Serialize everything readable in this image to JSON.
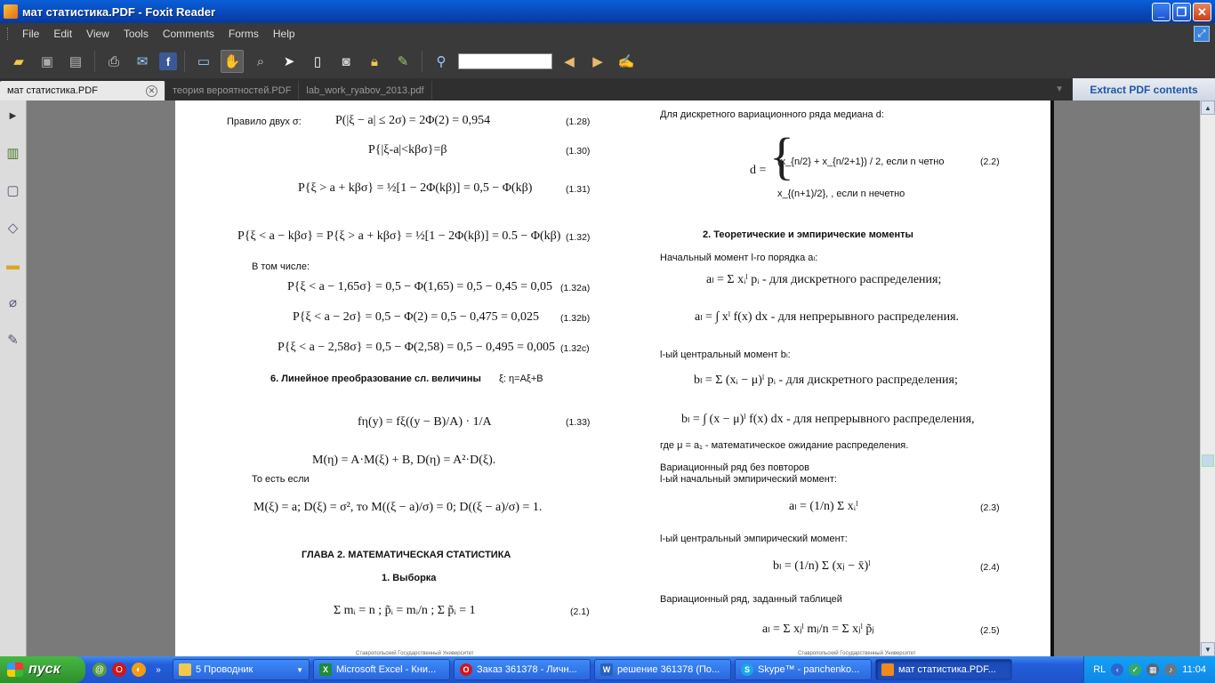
{
  "window": {
    "title": "мат статистика.PDF - Foxit Reader",
    "buttons": {
      "minimize": "_",
      "maximize": "❐",
      "close": "✕"
    }
  },
  "menu": [
    "File",
    "Edit",
    "View",
    "Tools",
    "Comments",
    "Forms",
    "Help"
  ],
  "toolbar": {
    "icons": [
      "open-icon",
      "save-icon",
      "print-setup-icon",
      "print-icon",
      "email-icon",
      "facebook-icon",
      "fullscreen-icon",
      "hand-tool-icon",
      "zoom-tool-icon",
      "select-tool-icon",
      "text-select-icon",
      "snapshot-icon",
      "rms-lock-icon",
      "sign-icon",
      "find-icon",
      "prev-icon",
      "next-icon",
      "typewriter-icon"
    ],
    "find_value": ""
  },
  "tabs": [
    {
      "label": "мат статистика.PDF",
      "active": true
    },
    {
      "label": "теория вероятностей.PDF",
      "active": false
    },
    {
      "label": "lab_work_ryabov_2013.pdf",
      "active": false
    }
  ],
  "extract_label": "Extract PDF contents",
  "left_panel": [
    "bookmarks-icon",
    "pages-icon",
    "layers-icon",
    "comments-icon",
    "attachments-icon",
    "signatures-icon"
  ],
  "page": {
    "left": {
      "rule_label": "Правило двух σ:",
      "eq128": "P(|ξ − a| ≤ 2σ) = 2Φ(2) = 0,954",
      "eq128_num": "(1.28)",
      "eq130": "P{|ξ-a|<kβσ}=β",
      "eq130_num": "(1.30)",
      "eq131": "P{ξ > a + kβσ} = ½[1 − 2Φ(kβ)] = 0,5 − Φ(kβ)",
      "eq131_num": "(1.31)",
      "eq132": "P{ξ < a − kβσ} = P{ξ > a + kβσ} = ½[1 − 2Φ(kβ)] = 0.5 − Φ(kβ)",
      "eq132_num": "(1.32)",
      "in_particular": "В том числе:",
      "eq132a": "P{ξ < a − 1,65σ} = 0,5 − Φ(1,65) = 0,5 − 0,45 = 0,05",
      "eq132a_num": "(1.32a)",
      "eq132b": "P{ξ < a − 2σ} = 0,5 − Φ(2) = 0,5 − 0,475 = 0,025",
      "eq132b_num": "(1.32b)",
      "eq132c": "P{ξ < a − 2,58σ} = 0,5 − Φ(2,58) = 0,5 − 0,495 = 0,005",
      "eq132c_num": "(1.32c)",
      "section6": "6.  Линейное  преобразование  сл.  величины",
      "section6_tail": "ξ:  η=Aξ+B",
      "eq133": "fη(y) = fξ((y − B)/A) · 1/A",
      "eq133_num": "(1.33)",
      "moments": "M(η) = A·M(ξ) + B,  D(η) = A²·D(ξ).",
      "that_is": "То  есть  если",
      "norm": "M(ξ) = a;   D(ξ) = σ²,   то   M((ξ − a)/σ) = 0;   D((ξ − a)/σ) = 1.",
      "chapter": "ГЛАВА 2.  МАТЕМАТИЧЕСКАЯ СТАТИСТИКА",
      "sample": "1.  Выборка",
      "eq21": "Σ mᵢ = n ;  p̃ᵢ = mᵢ/n ;  Σ p̃ᵢ = 1",
      "eq21_num": "(2.1)",
      "footer": "Ставропольский Государственный Университет"
    },
    "right": {
      "median_intro": "Для  дискретного  вариационного  ряда  медиана  d:",
      "median_d": "d =",
      "median_case1": "(x_{n/2} + x_{n/2+1}) / 2, если n четно",
      "median_case2": "x_{(n+1)/2},        , если n нечетно",
      "eq22_num": "(2.2)",
      "section2": "2.  Теоретические  и  эмпирические  моменты",
      "initial_moment": "Начальный  момент  l-го  порядка  aₗ:",
      "al_discrete": "aₗ = Σ xᵢˡ pᵢ  - для  дискретного  распределения;",
      "al_continuous": "aₗ = ∫ xˡ f(x) dx  - для  непрерывного  распределения.",
      "central_moment": "l-ый  центральный  момент  bₗ:",
      "bl_discrete": "bₗ = Σ (xᵢ − μ)ˡ pᵢ - для  дискретного  распределения;",
      "bl_continuous": "bₗ = ∫ (x − μ)ˡ f(x) dx  - для  непрерывного  распределения,",
      "where_mu": "где   μ = a₁  - математическое ожидание распределения.",
      "series_norepeat": "Вариационный ряд без повторов",
      "emp_initial": "l-ый  начальный  эмпирический  момент:",
      "eq23": "aₗ = (1/n) Σ xᵢˡ",
      "eq23_num": "(2.3)",
      "emp_central": "l-ый  центральный  эмпирический  момент:",
      "eq24": "bₗ = (1/n) Σ (xⱼ − x̄)ˡ",
      "eq24_num": "(2.4)",
      "series_table": "Вариационный  ряд,  заданный  таблицей",
      "eq25": "aₗ = Σ xⱼˡ mⱼ/n = Σ xⱼˡ p̃ⱼ",
      "eq25_num": "(2.5)",
      "footer": "Ставропольский Государственный Университет"
    }
  },
  "taskbar": {
    "start": "пуск",
    "tasks": [
      {
        "label": "5 Проводник",
        "icon": "folder-icon",
        "color": "#f3c94a",
        "active": false
      },
      {
        "label": "Microsoft Excel - Кни...",
        "icon": "excel-icon",
        "color": "#1f8a3a",
        "active": false
      },
      {
        "label": "Заказ 361378 - Личн...",
        "icon": "opera-icon",
        "color": "#d0161b",
        "active": false
      },
      {
        "label": "решение 361378 (По...",
        "icon": "word-icon",
        "color": "#2b5fb8",
        "active": false
      },
      {
        "label": "Skype™ - panchenko...",
        "icon": "skype-icon",
        "color": "#18a8e8",
        "active": false
      },
      {
        "label": "мат статистика.PDF...",
        "icon": "foxit-icon",
        "color": "#f08a1a",
        "active": true
      }
    ],
    "lang": "RL",
    "clock": "11:04"
  }
}
